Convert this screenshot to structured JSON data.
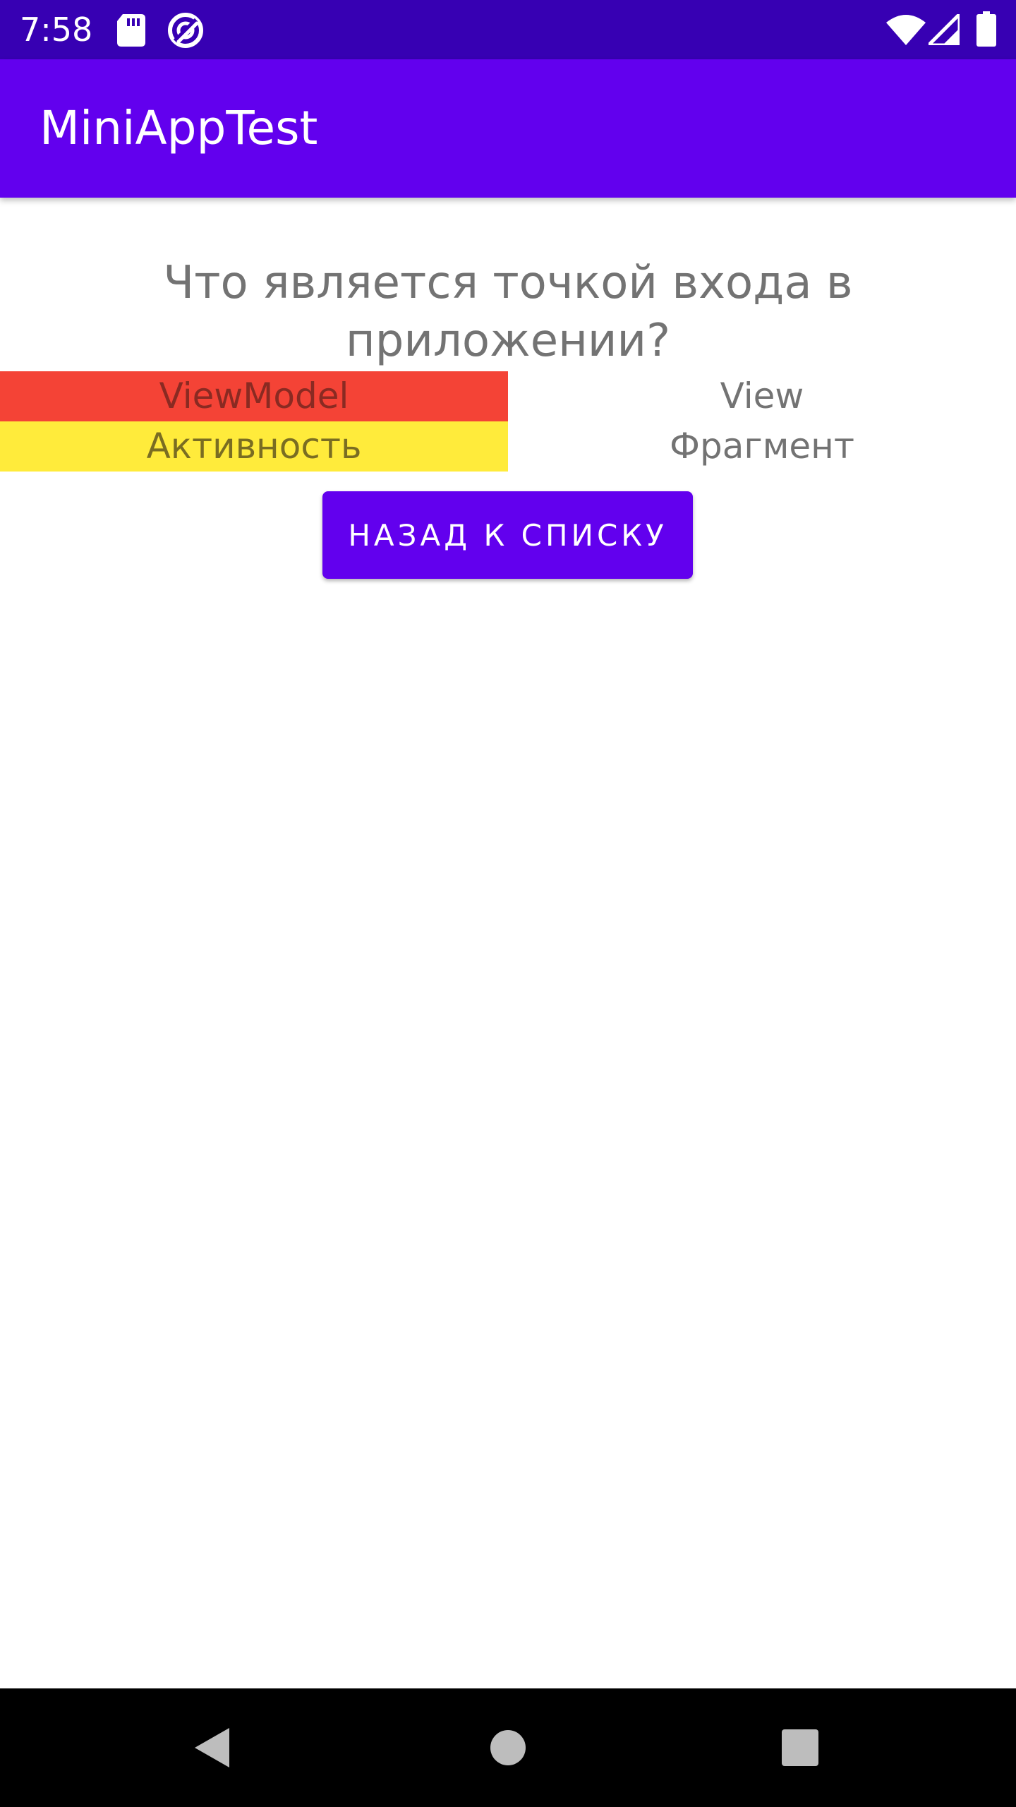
{
  "status_bar": {
    "time": "7:58",
    "icons": [
      "sd-card-icon",
      "data-saver-icon",
      "wifi-icon",
      "signal-icon",
      "battery-icon"
    ]
  },
  "app_bar": {
    "title": "MiniAppTest"
  },
  "question": {
    "text": "Что является точкой входа в приложении?"
  },
  "answers": [
    {
      "label": "ViewModel",
      "highlight": "#f44336"
    },
    {
      "label": "View",
      "highlight": null
    },
    {
      "label": "Активность",
      "highlight": "#ffeb3b"
    },
    {
      "label": "Фрагмент",
      "highlight": null
    }
  ],
  "actions": {
    "back_label": "НАЗАД К СПИСКУ"
  },
  "nav_bar": {
    "icons": [
      "back-triangle-icon",
      "home-circle-icon",
      "recents-square-icon"
    ]
  },
  "colors": {
    "status_bar": "#3700b3",
    "primary": "#6200ee",
    "wrong_answer": "#f44336",
    "correct_answer": "#ffeb3b",
    "text_gray": "#737373"
  }
}
